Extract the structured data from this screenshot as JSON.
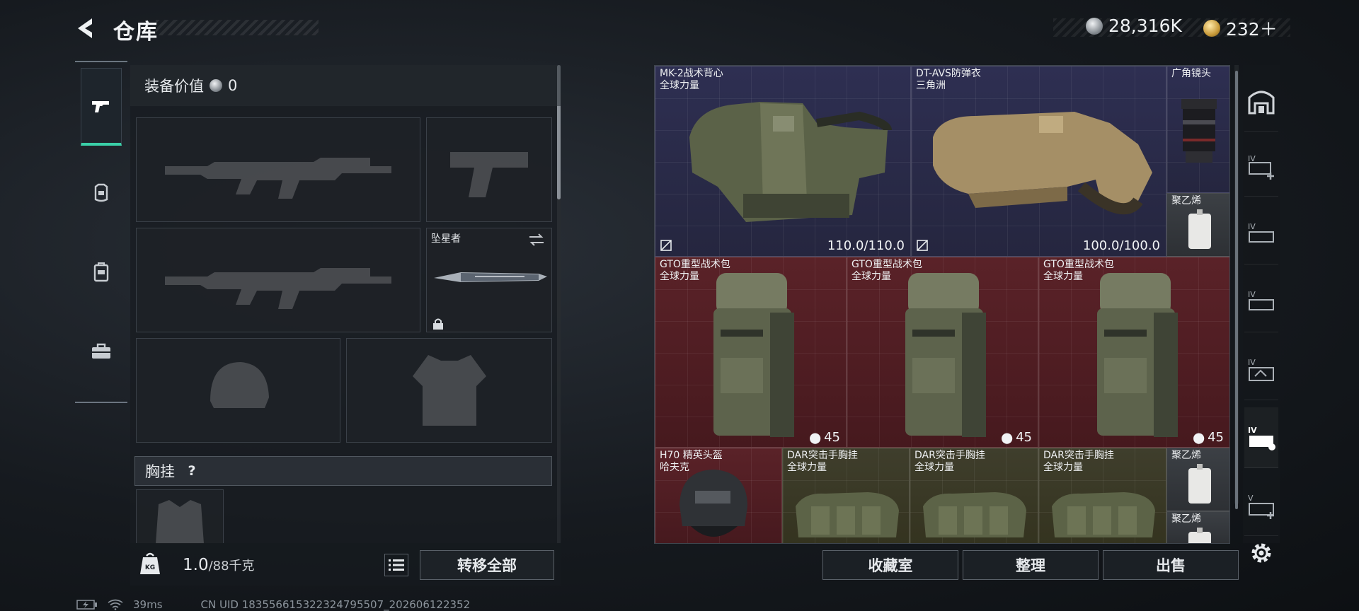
{
  "header": {
    "title": "仓库"
  },
  "currency": {
    "silver": "28,316K",
    "gold": "232＋"
  },
  "equipment": {
    "value_label": "装备价值",
    "value": "0",
    "melee_name": "坠星者",
    "chest_label": "胸挂",
    "chest_help": "?"
  },
  "bottom_left": {
    "weight": "1.0",
    "weight_max": "/88千克",
    "weight_icon_text": "KG",
    "transfer_all": "转移全部"
  },
  "status_bar": {
    "ping": "39ms",
    "uid": "CN UID 18355661532232479550​7_202606122352"
  },
  "items": {
    "mk2": {
      "name": "MK-2战术背心",
      "sub": "全球力量",
      "durability": "110.0/110.0"
    },
    "dtavs": {
      "name": "DT-AVS防弹衣",
      "sub": "三角洲",
      "durability": "100.0/100.0"
    },
    "lens": {
      "name": "广角镜头"
    },
    "pe1": {
      "name": "聚乙烯"
    },
    "gto1": {
      "name": "GTO重型战术包",
      "sub": "全球力量",
      "count": "45"
    },
    "gto2": {
      "name": "GTO重型战术包",
      "sub": "全球力量",
      "count": "45"
    },
    "gto3": {
      "name": "GTO重型战术包",
      "sub": "全球力量",
      "count": "45"
    },
    "h70": {
      "name": "H70 精英头盔",
      "sub": "哈夫克"
    },
    "dar1": {
      "name": "DAR突击手胸挂",
      "sub": "全球力量"
    },
    "dar2": {
      "name": "DAR突击手胸挂",
      "sub": "全球力量"
    },
    "dar3": {
      "name": "DAR突击手胸挂",
      "sub": "全球力量"
    },
    "pe2": {
      "name": "聚乙烯"
    },
    "pe3": {
      "name": "聚乙烯"
    }
  },
  "actions": {
    "collection": "收藏室",
    "sort": "整理",
    "sell": "出售"
  },
  "right_rail": {
    "tiers": [
      "IV",
      "IV",
      "IV",
      "IV",
      "IV",
      "V"
    ]
  },
  "colors": {
    "accent": "#3ad0a8",
    "purple_rarity": "#2e2f52",
    "red_rarity": "#5a2228",
    "olive_rarity": "#3f3e2c"
  }
}
